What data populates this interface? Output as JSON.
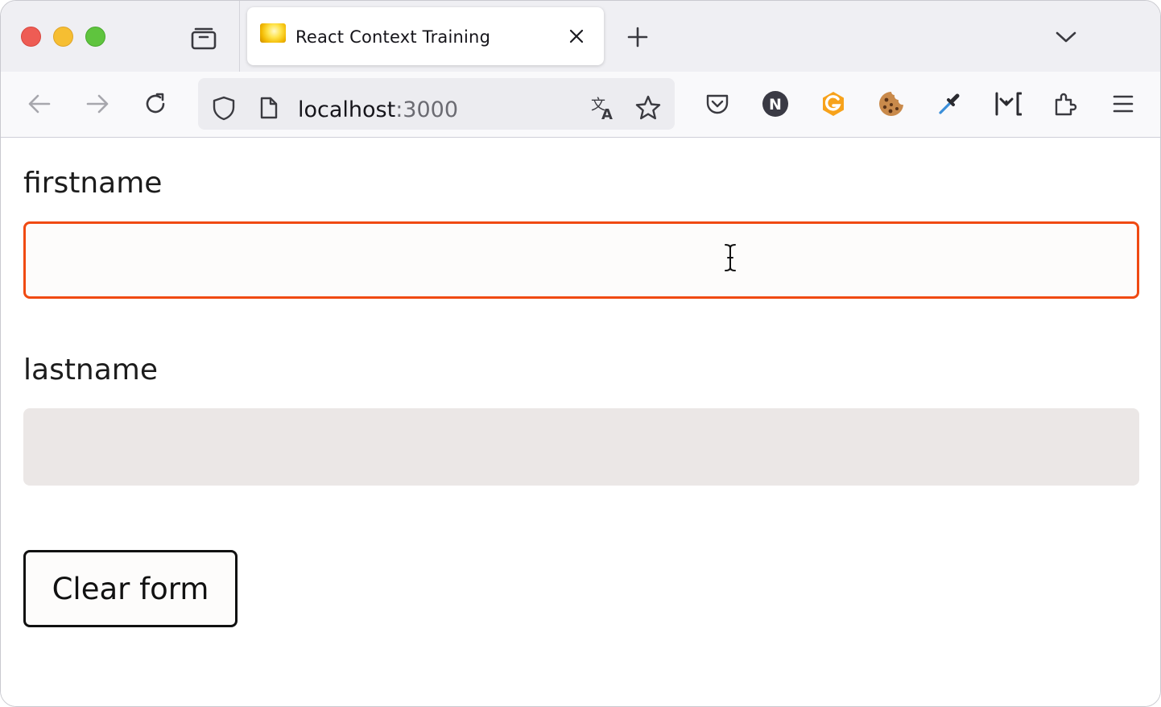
{
  "browser": {
    "tab": {
      "title": "React Context Training",
      "favicon": "lightbulb-favicon"
    },
    "url": {
      "host": "localhost",
      "port": ":3000"
    },
    "icons": [
      "back-icon",
      "forward-icon",
      "reload-icon",
      "shield-icon",
      "page-icon",
      "translate-icon",
      "bookmark-star-icon",
      "pocket-icon",
      "n-extension-icon",
      "g-extension-icon",
      "cookie-extension-icon",
      "eyedropper-icon",
      "inspect-extension-icon",
      "extensions-puzzle-icon",
      "menu-icon"
    ]
  },
  "form": {
    "firstname_label": "firstname",
    "firstname_value": "",
    "lastname_label": "lastname",
    "lastname_value": "",
    "clear_button": "Clear form"
  },
  "colors": {
    "focus_border": "#f04a12",
    "disabled_input_bg": "#ebe7e6",
    "button_border": "#111111"
  }
}
